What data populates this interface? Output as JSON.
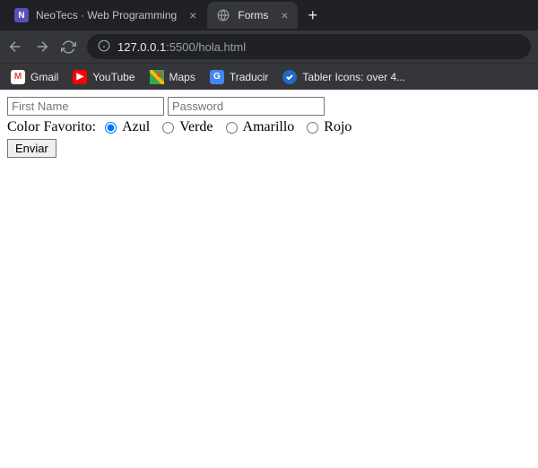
{
  "browser": {
    "tabs": [
      {
        "title": "NeoTecs · Web Programming",
        "favicon": "N"
      },
      {
        "title": "Forms",
        "favicon": "globe"
      }
    ],
    "url": {
      "host": "127.0.0.1",
      "port_path": ":5500/hola.html"
    },
    "bookmarks": [
      {
        "label": "Gmail",
        "icon": "M"
      },
      {
        "label": "YouTube",
        "icon": "▶"
      },
      {
        "label": "Maps",
        "icon": "maps"
      },
      {
        "label": "Traducir",
        "icon": "G"
      },
      {
        "label": "Tabler Icons: over 4...",
        "icon": "tabler"
      }
    ]
  },
  "form": {
    "first_name_placeholder": "First Name",
    "password_placeholder": "Password",
    "color_label": "Color Favorito:",
    "colors": {
      "azul": "Azul",
      "verde": "Verde",
      "amarillo": "Amarillo",
      "rojo": "Rojo"
    },
    "submit_label": "Enviar"
  }
}
